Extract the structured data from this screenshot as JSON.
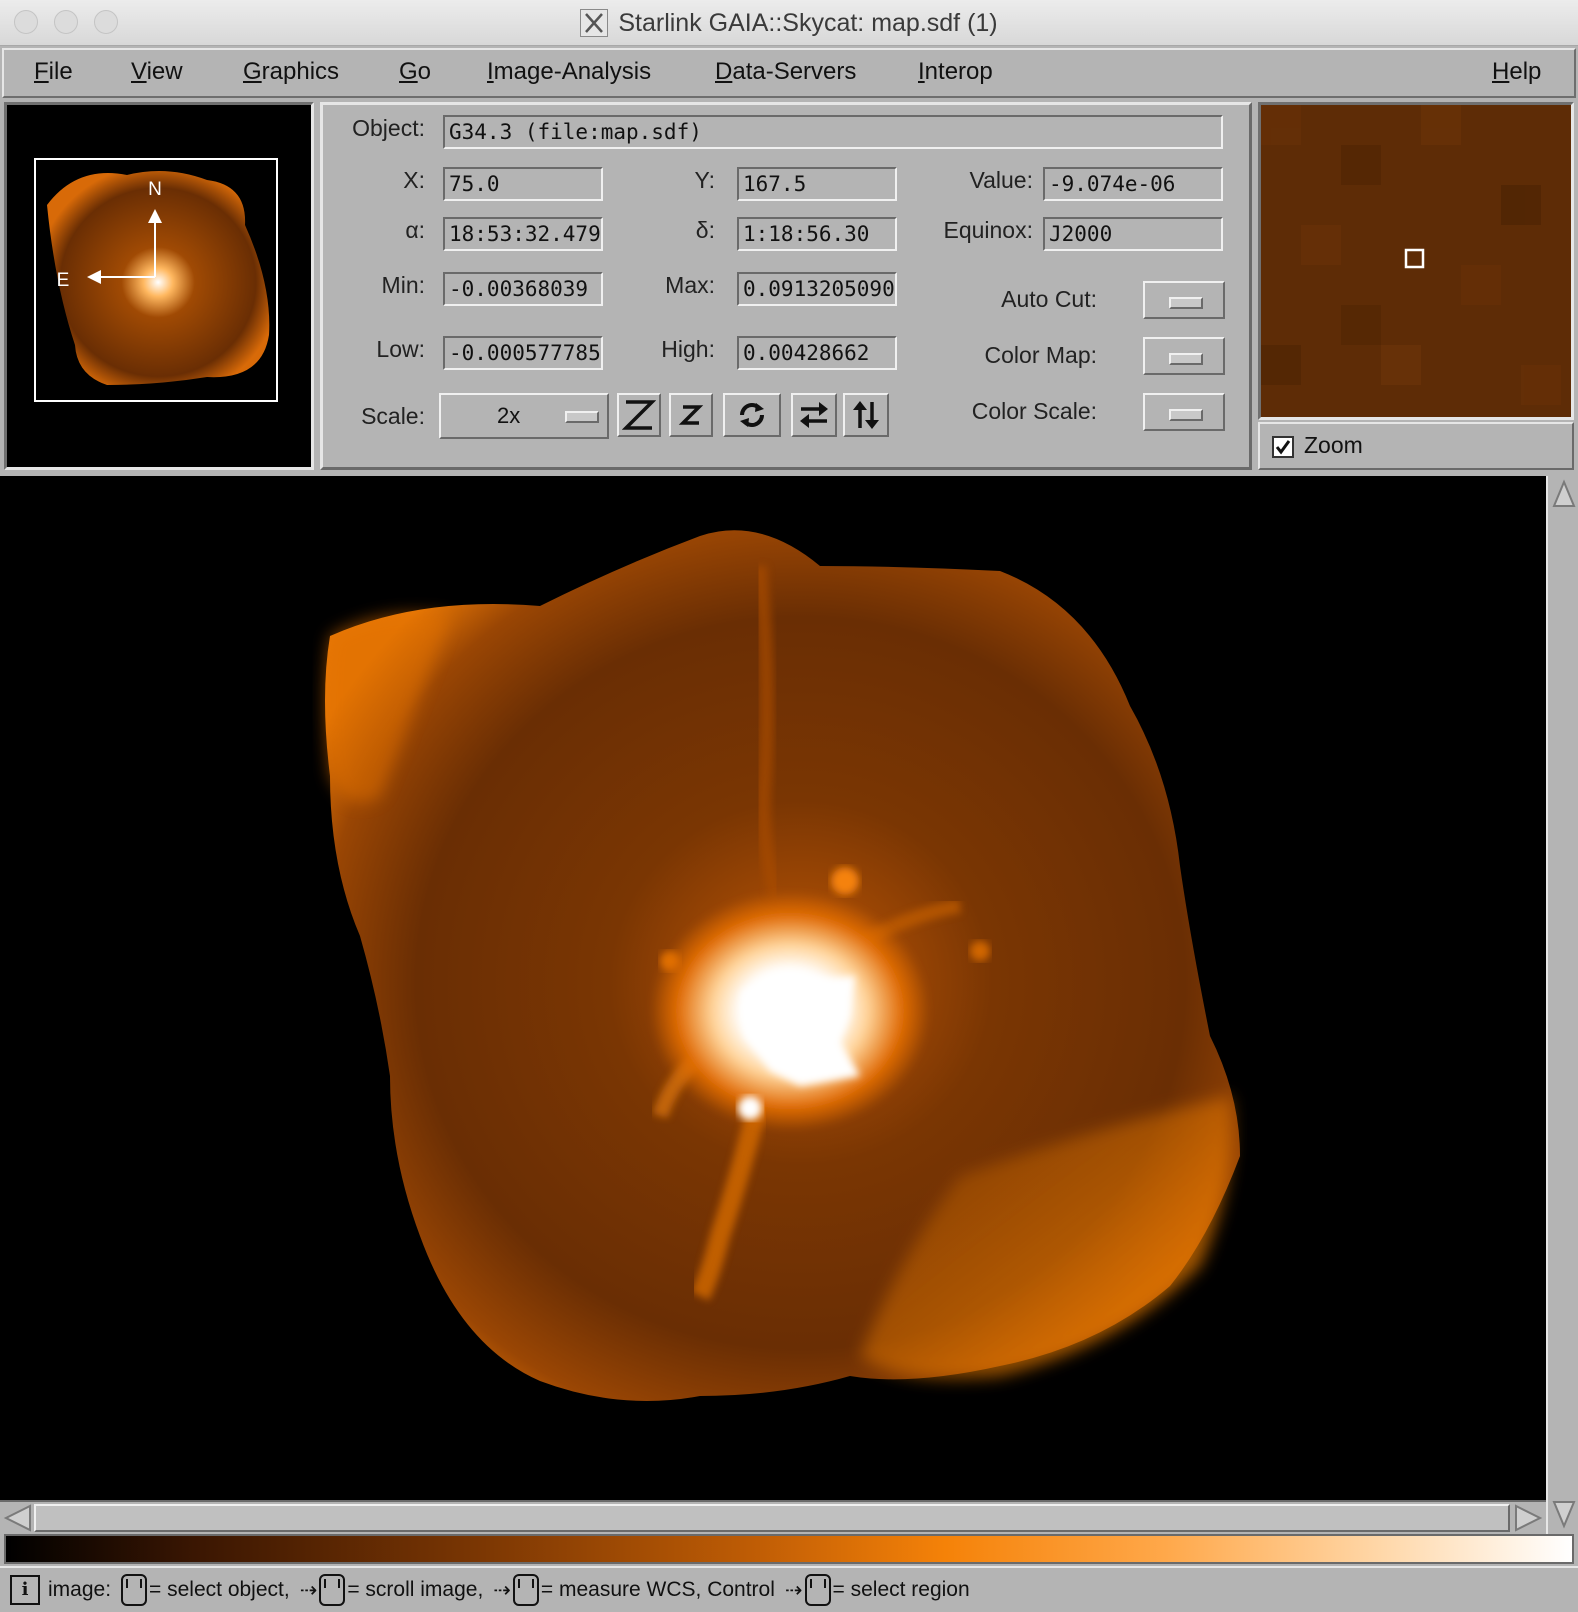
{
  "window": {
    "title": "Starlink GAIA::Skycat: map.sdf (1)"
  },
  "menus": [
    {
      "label": "File",
      "u": "F",
      "rest": "ile"
    },
    {
      "label": "View",
      "u": "V",
      "rest": "iew"
    },
    {
      "label": "Graphics",
      "u": "G",
      "rest": "raphics"
    },
    {
      "label": "Go",
      "u": "G",
      "rest": "o"
    },
    {
      "label": "Image-Analysis",
      "u": "I",
      "rest": "mage-Analysis"
    },
    {
      "label": "Data-Servers",
      "u": "D",
      "rest": "ata-Servers"
    },
    {
      "label": "Interop",
      "u": "I",
      "rest": "nterop"
    },
    {
      "label": "Help",
      "u": "H",
      "rest": "elp"
    }
  ],
  "panner": {
    "north_label": "N",
    "east_label": "E"
  },
  "info": {
    "object_label": "Object:",
    "object_value": "G34.3 (file:map.sdf)",
    "x_label": "X:",
    "x_value": "75.0",
    "y_label": "Y:",
    "y_value": "167.5",
    "value_label": "Value:",
    "value_value": "-9.074e-06",
    "alpha_label": "α:",
    "alpha_value": "18:53:32.479",
    "delta_label": "δ:",
    "delta_value": "1:18:56.30",
    "equinox_label": "Equinox:",
    "equinox_value": "J2000",
    "min_label": "Min:",
    "min_value": "-0.00368039",
    "max_label": "Max:",
    "max_value": "0.0913205090",
    "low_label": "Low:",
    "low_value": "-0.000577785",
    "high_label": "High:",
    "high_value": "0.00428662",
    "scale_label": "Scale:",
    "scale_value": "2x",
    "autocut_label": "Auto Cut:",
    "colormap_label": "Color Map:",
    "colorscale_label": "Color Scale:"
  },
  "zoom": {
    "checkbox_label": "Zoom",
    "checked": true
  },
  "status": {
    "icon": "i",
    "prefix": "image:",
    "part1": "= select object,",
    "part2": "= scroll image,",
    "part3": "= measure WCS, Control",
    "part4": "= select region"
  },
  "colors": {
    "chrome": "#b4b4b4",
    "image_orange": "#f58208",
    "image_dark": "#5e2c06"
  }
}
